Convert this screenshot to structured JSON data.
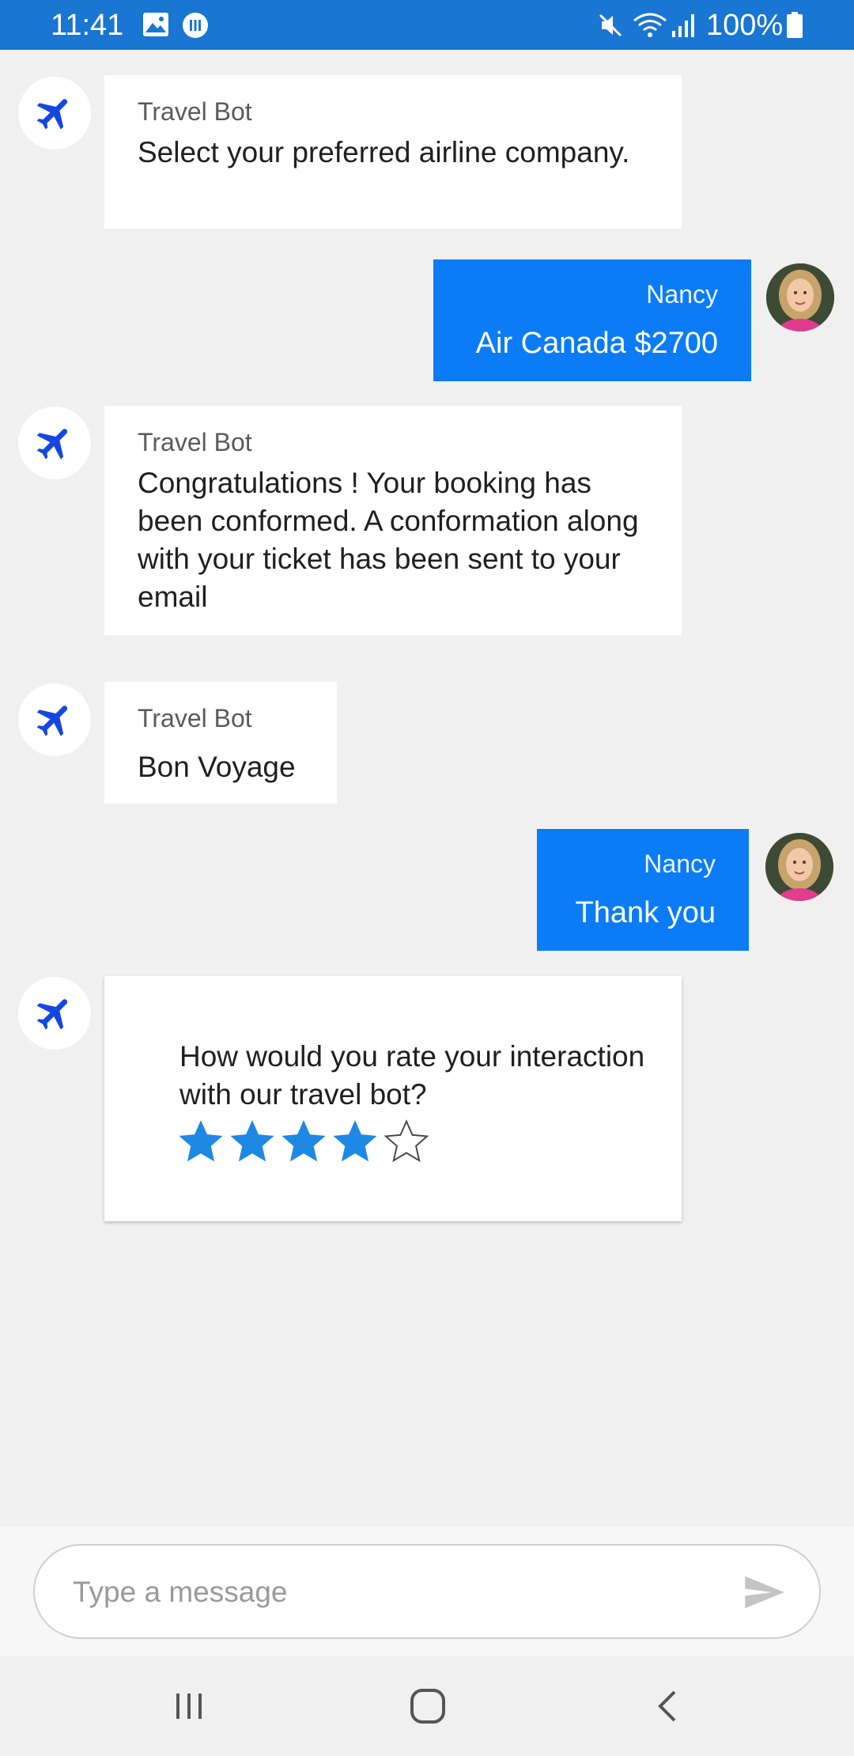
{
  "status_bar": {
    "time": "11:41",
    "battery": "100%",
    "icons": [
      "gallery-icon",
      "media-icon",
      "mute-icon",
      "wifi-icon",
      "signal-icon",
      "battery-icon"
    ],
    "color": "#1976d2"
  },
  "messages": [
    {
      "from": "bot",
      "sender": "Travel Bot",
      "text": "Select your preferred airline company."
    },
    {
      "from": "user",
      "sender": "Nancy",
      "text": "Air Canada $2700"
    },
    {
      "from": "bot",
      "sender": "Travel Bot",
      "text": "Congratulations ! Your booking has been conformed. A conformation along with your ticket has been sent to your email"
    },
    {
      "from": "bot",
      "sender": "Travel Bot",
      "text": "Bon Voyage"
    },
    {
      "from": "user",
      "sender": "Nancy",
      "text": "Thank you"
    }
  ],
  "rating": {
    "question": "How would you rate your interaction with our travel bot?",
    "value": 4,
    "max": 5,
    "star_color": "#1e88e5"
  },
  "composer": {
    "placeholder": "Type a message",
    "send_icon": "send-icon"
  },
  "nav_bar": {
    "icons": [
      "recent-apps-icon",
      "home-icon",
      "back-icon"
    ]
  },
  "colors": {
    "user_bubble": "#0b7cf5",
    "bot_icon": "#1546e0",
    "background": "#f0f0f0"
  }
}
